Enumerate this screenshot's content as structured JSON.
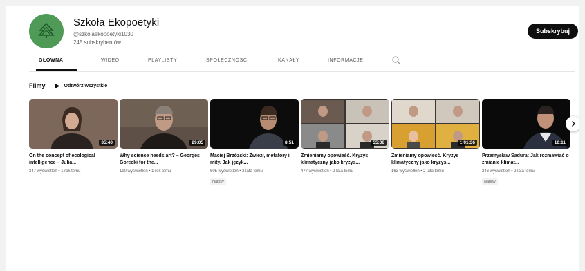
{
  "channel": {
    "name": "Szkoła Ekopoetyki",
    "handle": "@szkolaekopoetyki1030",
    "subscribers": "245 subskrybentów",
    "avatar_color": "#4f9a57",
    "avatar_icon": "pine-tree-icon",
    "subscribe_label": "Subskrybuj"
  },
  "tabs": [
    {
      "label": "GŁÓWNA",
      "active": true
    },
    {
      "label": "WIDEO",
      "active": false
    },
    {
      "label": "PLAYLISTY",
      "active": false
    },
    {
      "label": "SPOŁECZNOŚĆ",
      "active": false
    },
    {
      "label": "KANAŁY",
      "active": false
    },
    {
      "label": "INFORMACJE",
      "active": false
    }
  ],
  "tab_search_icon": "search-icon",
  "section": {
    "title": "Filmy",
    "play_all_label": "Odtwórz wszystkie"
  },
  "videos": [
    {
      "title": "On the concept of ecological intelligence – Julia...",
      "meta": "347 wyświetleń • 1 rok temu",
      "duration": "35:40",
      "badge": ""
    },
    {
      "title": "Why science needs art? – Georges Gorecki for the...",
      "meta": "190 wyświetleń • 1 rok temu",
      "duration": "29:05",
      "badge": ""
    },
    {
      "title": "Maciej Brzózski: Zwięzł, metafory i mity. Jak język...",
      "meta": "605 wyświetleń • 2 lata temu",
      "duration": "8:51",
      "badge": "Napisy"
    },
    {
      "title": "Zmieniamy opowieść. Kryzys klimatyczny jako kryzys...",
      "meta": "477 wyświetleń • 2 lata temu",
      "duration": "55:06",
      "badge": ""
    },
    {
      "title": "Zmieniamy opowieść. Kryzys klimatyczny jako kryzys...",
      "meta": "163 wyświetleń • 2 lata temu",
      "duration": "1:01:36",
      "badge": ""
    },
    {
      "title": "Przemysław Sadura: Jak rozmawiać o zmianie klimat...",
      "meta": "246 wyświetleń • 2 lata temu",
      "duration": "10:11",
      "badge": "Napisy"
    }
  ],
  "next_icon": "chevron-right-icon"
}
